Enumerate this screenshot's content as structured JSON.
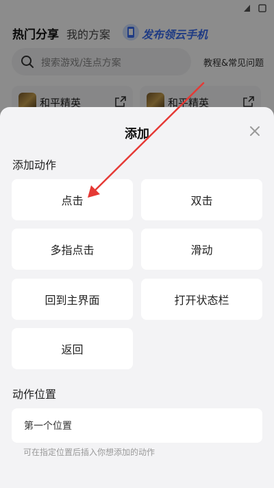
{
  "background": {
    "tabs": {
      "hot": "热门分享",
      "mine": "我的方案",
      "cloud_phone": "发布领云手机"
    },
    "search": {
      "placeholder": "搜索游戏/连点方案"
    },
    "help_link": "教程&常见问题",
    "cards": [
      {
        "game": "和平精英"
      },
      {
        "game": "和平精英"
      }
    ]
  },
  "sheet": {
    "title": "添加",
    "actions_label": "添加动作",
    "actions": [
      {
        "label": "点击"
      },
      {
        "label": "双击"
      },
      {
        "label": "多指点击"
      },
      {
        "label": "滑动"
      },
      {
        "label": "回到主界面"
      },
      {
        "label": "打开状态栏"
      },
      {
        "label": "返回"
      }
    ],
    "position_label": "动作位置",
    "position_value": "第一个位置",
    "position_hint": "可在指定位置后插入你想添加的动作"
  },
  "colors": {
    "accent_arrow": "#e53935",
    "cloud_brand": "#3b6df0",
    "sheet_bg": "#f3f3f5"
  },
  "icons": [
    "search-icon",
    "share-icon",
    "close-icon",
    "cloud-phone-icon"
  ]
}
